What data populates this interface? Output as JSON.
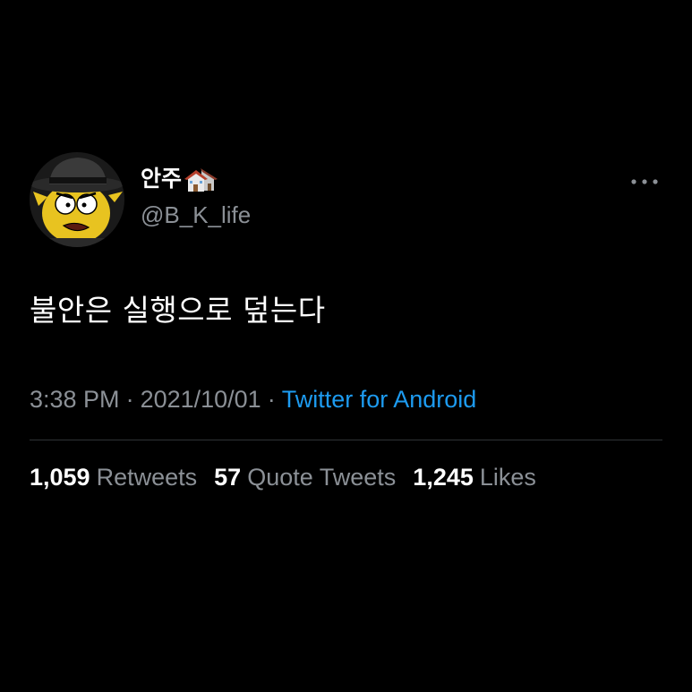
{
  "author": {
    "display_name": "안주",
    "display_name_emoji": "house-buildings-icon",
    "handle": "@B_K_life"
  },
  "tweet": {
    "text": "불안은 실행으로 덮는다",
    "time": "3:38 PM",
    "date": "2021/10/01",
    "separator": "·",
    "source": "Twitter for Android"
  },
  "stats": {
    "retweets_count": "1,059",
    "retweets_label": "Retweets",
    "quotes_count": "57",
    "quotes_label": "Quote Tweets",
    "likes_count": "1,245",
    "likes_label": "Likes"
  },
  "colors": {
    "background": "#000000",
    "primary_text": "#ffffff",
    "secondary_text": "#8b9096",
    "link": "#1d9bf0",
    "divider": "#2f3336"
  }
}
